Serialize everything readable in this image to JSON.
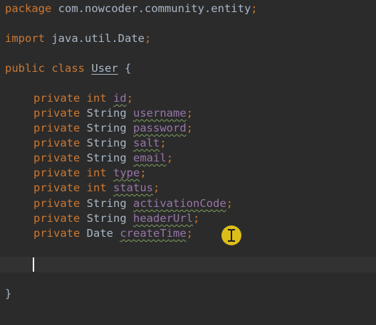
{
  "editor": {
    "package_kw": "package",
    "package_name": "com.nowcoder.community.entity",
    "import_kw": "import",
    "import_name": "java.util.Date",
    "semicolon": ";",
    "public_kw": "public",
    "class_kw": "class",
    "class_name": "User",
    "open_brace": "{",
    "close_brace": "}",
    "private_kw": "private",
    "fields": [
      {
        "type": "int",
        "name": "id"
      },
      {
        "type": "String",
        "name": "username"
      },
      {
        "type": "String",
        "name": "password"
      },
      {
        "type": "String",
        "name": "salt"
      },
      {
        "type": "String",
        "name": "email"
      },
      {
        "type": "int",
        "name": "type"
      },
      {
        "type": "int",
        "name": "status"
      },
      {
        "type": "String",
        "name": "activationCode"
      },
      {
        "type": "String",
        "name": "headerUrl"
      },
      {
        "type": "Date",
        "name": "createTime"
      }
    ]
  },
  "cursor": {
    "icon": "text-cursor-icon",
    "highlight_color": "#e6c619"
  }
}
